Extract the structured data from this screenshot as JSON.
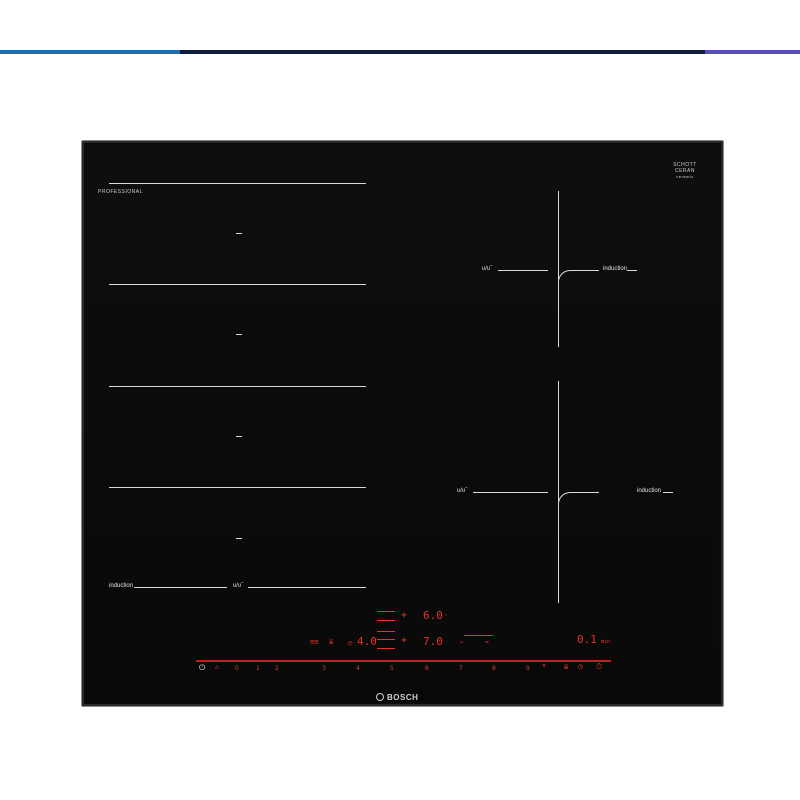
{
  "header_bar": {
    "colors": [
      "#1f6fb0",
      "#0f1e3c",
      "#5a4fb8"
    ]
  },
  "hob": {
    "series_label": "PROFESSIONAL",
    "glass_brand": {
      "line1": "SCHOTT",
      "line2": "CERAN",
      "line3": "ceramic"
    },
    "brand": "BOSCH",
    "left_zone": {
      "label_induction": "induction",
      "label_flex": "ᴜ/ᴜ‾"
    },
    "right_top_zone": {
      "label_flex": "ᴜ/ᴜ‾",
      "label_induction": "induction"
    },
    "right_bottom_zone": {
      "label_flex": "ᴜ/ᴜ‾",
      "label_induction": "induction"
    },
    "controls": {
      "power_level_top": "6.0",
      "power_level_mid": "7.0",
      "power_level_left": "4.0",
      "timer_display": "0.1",
      "scale": [
        "0",
        "1",
        "2",
        "3",
        "4",
        "5",
        "6",
        "7",
        "8",
        "9"
      ],
      "accent_color": "#e8322a"
    }
  }
}
